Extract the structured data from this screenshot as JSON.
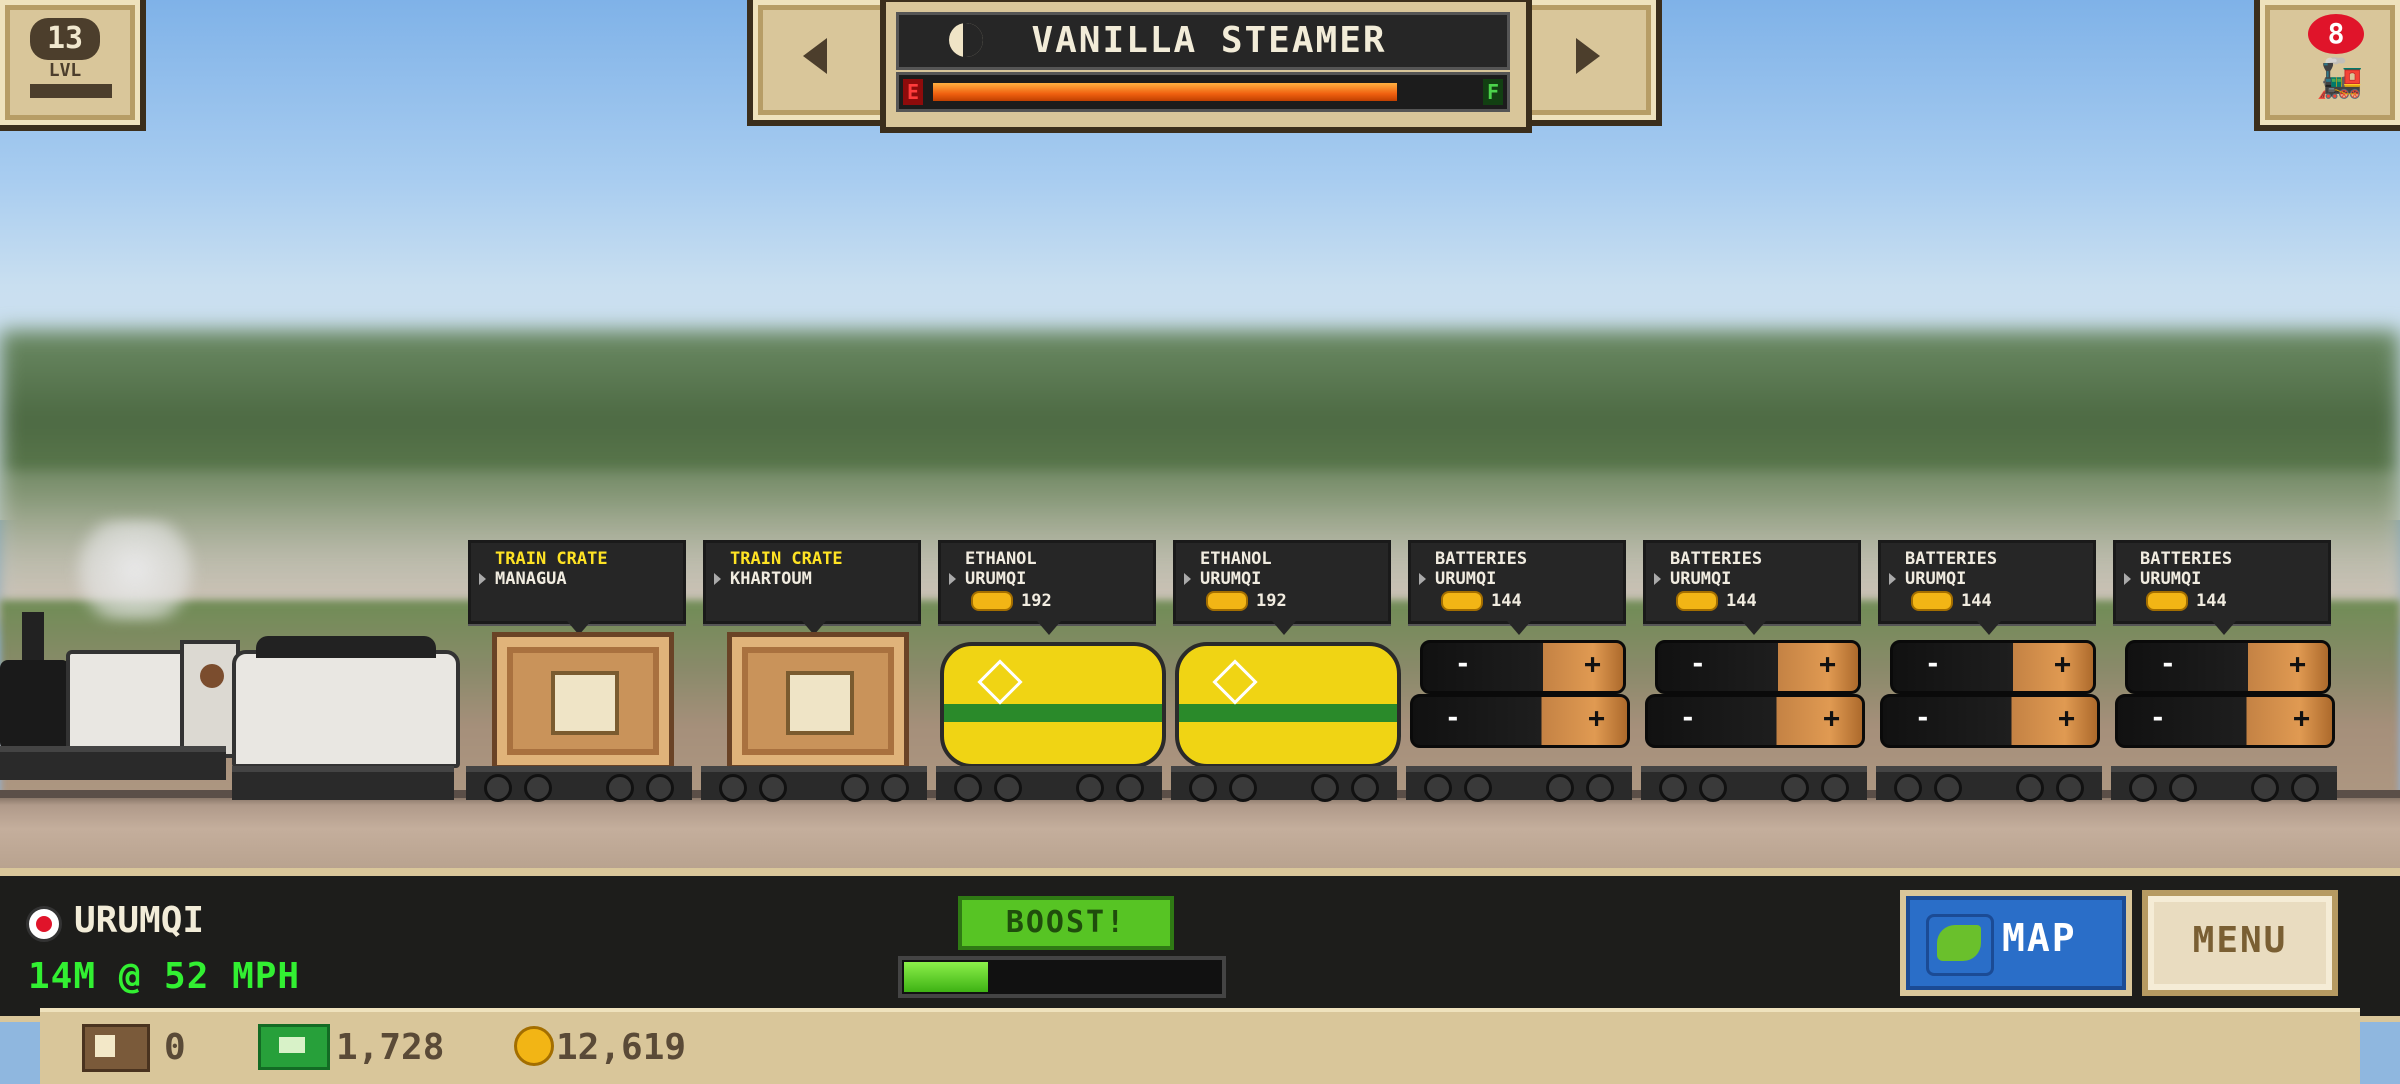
{
  "level": {
    "number": "13",
    "label": "LVL"
  },
  "train_badge": {
    "count": "8"
  },
  "header": {
    "title": "VANILLA STEAMER",
    "fuel_empty_label": "E",
    "fuel_full_label": "F",
    "fuel_level": 0.86
  },
  "cars": [
    {
      "type": "crate",
      "line1": "TRAIN CRATE",
      "line2": "MANAGUA"
    },
    {
      "type": "crate",
      "line1": "TRAIN CRATE",
      "line2": "KHARTOUM"
    },
    {
      "type": "tank",
      "line1": "ETHANOL",
      "line2": "URUMQI",
      "pay": "192"
    },
    {
      "type": "tank",
      "line1": "ETHANOL",
      "line2": "URUMQI",
      "pay": "192"
    },
    {
      "type": "battery",
      "line1": "BATTERIES",
      "line2": "URUMQI",
      "pay": "144"
    },
    {
      "type": "battery",
      "line1": "BATTERIES",
      "line2": "URUMQI",
      "pay": "144"
    },
    {
      "type": "battery",
      "line1": "BATTERIES",
      "line2": "URUMQI",
      "pay": "144"
    },
    {
      "type": "battery",
      "line1": "BATTERIES",
      "line2": "URUMQI",
      "pay": "144"
    }
  ],
  "status": {
    "station": "URUMQI",
    "distance_speed": "14M @ 52 MPH",
    "boost_label": "BOOST!",
    "boost_level": 0.27
  },
  "buttons": {
    "map": "MAP",
    "menu": "MENU"
  },
  "resources": {
    "crates": "0",
    "cash": "1,728",
    "coins": "12,619"
  },
  "colors": {
    "accent_tan": "#d9c69a",
    "boost_green": "#57c424",
    "map_blue": "#2a6ec8",
    "speed_green": "#32f032",
    "alert_red": "#e0142a"
  }
}
